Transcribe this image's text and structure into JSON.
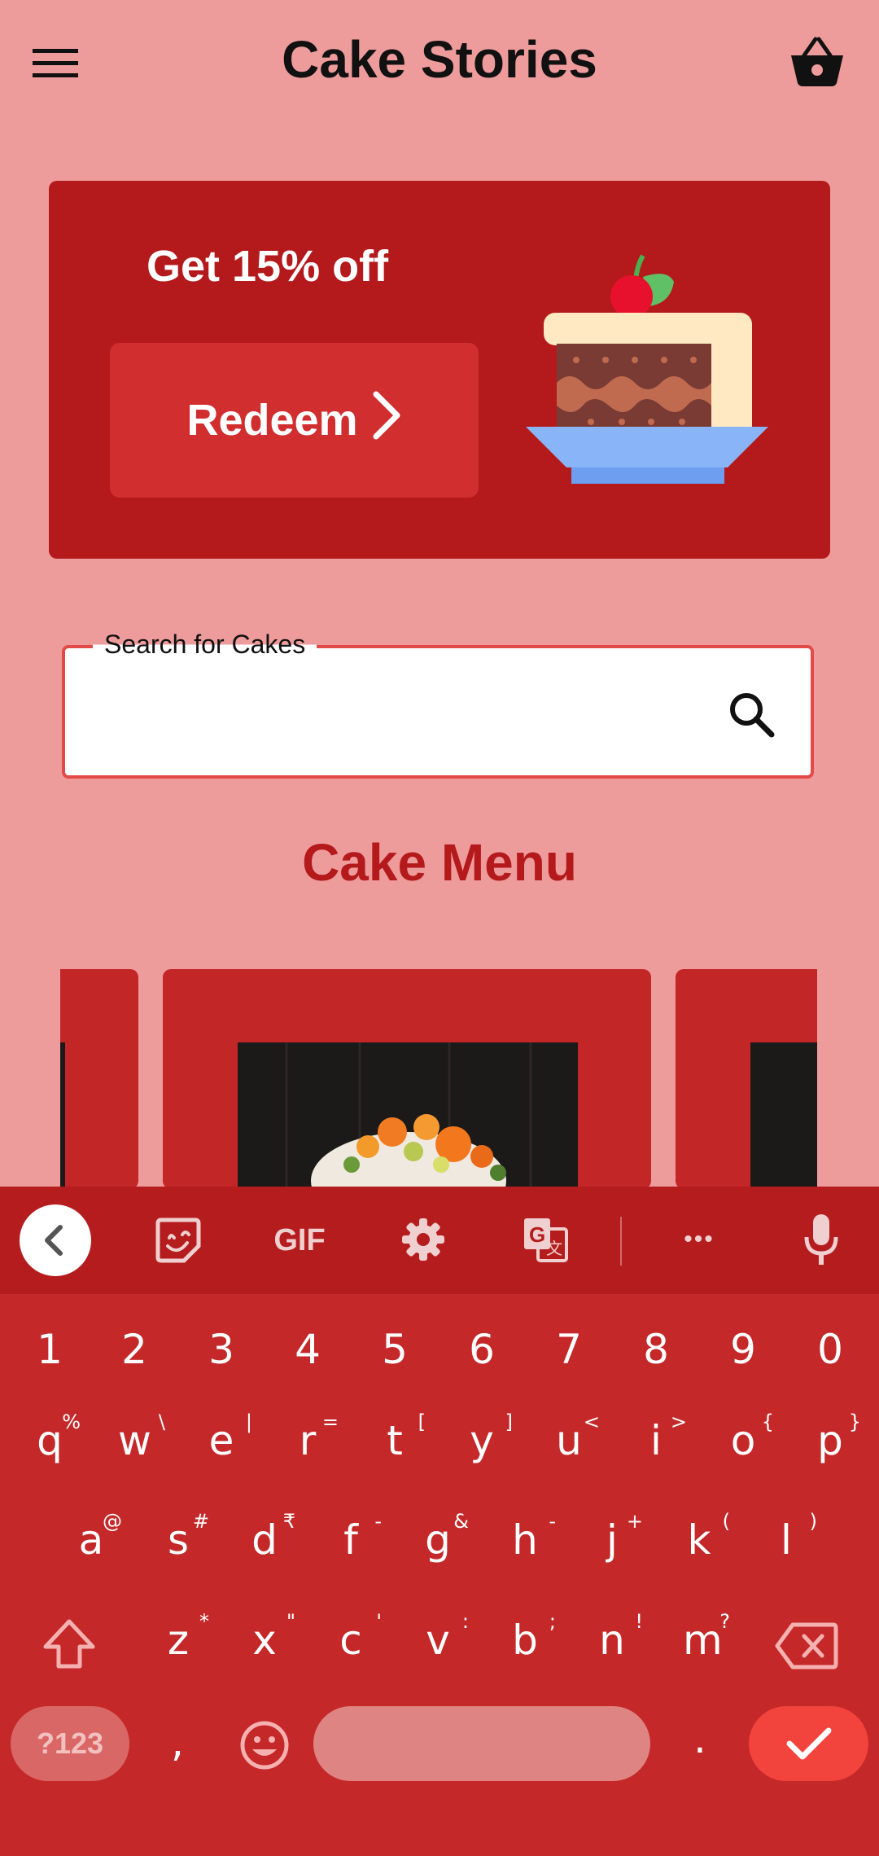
{
  "app": {
    "title": "Cake Stories"
  },
  "promo": {
    "text": "Get 15% off",
    "button_label": "Redeem"
  },
  "search": {
    "label": "Search for Cakes",
    "value": ""
  },
  "menu": {
    "heading": "Cake Menu"
  },
  "keyboard": {
    "toolbar": [
      "sticker-icon",
      "GIF",
      "gear-icon",
      "translate-icon",
      "more-icon",
      "mic-icon"
    ],
    "gif_label": "GIF",
    "more_label": "•••",
    "numbers": [
      "1",
      "2",
      "3",
      "4",
      "5",
      "6",
      "7",
      "8",
      "9",
      "0"
    ],
    "row1": [
      {
        "k": "q",
        "s": "%"
      },
      {
        "k": "w",
        "s": "\\"
      },
      {
        "k": "e",
        "s": "|"
      },
      {
        "k": "r",
        "s": "="
      },
      {
        "k": "t",
        "s": "["
      },
      {
        "k": "y",
        "s": "]"
      },
      {
        "k": "u",
        "s": "<"
      },
      {
        "k": "i",
        "s": ">"
      },
      {
        "k": "o",
        "s": "{"
      },
      {
        "k": "p",
        "s": "}"
      }
    ],
    "row2": [
      {
        "k": "a",
        "s": "@"
      },
      {
        "k": "s",
        "s": "#"
      },
      {
        "k": "d",
        "s": "₹"
      },
      {
        "k": "f",
        "s": "-"
      },
      {
        "k": "g",
        "s": "&"
      },
      {
        "k": "h",
        "s": "-"
      },
      {
        "k": "j",
        "s": "+"
      },
      {
        "k": "k",
        "s": "("
      },
      {
        "k": "l",
        "s": ")"
      }
    ],
    "row3": [
      {
        "k": "z",
        "s": "*"
      },
      {
        "k": "x",
        "s": "\""
      },
      {
        "k": "c",
        "s": "'"
      },
      {
        "k": "v",
        "s": ":"
      },
      {
        "k": "b",
        "s": ";"
      },
      {
        "k": "n",
        "s": "!"
      },
      {
        "k": "m",
        "s": "?"
      }
    ],
    "symbols_label": "?123",
    "comma": ",",
    "period": "."
  },
  "colors": {
    "background": "#ee9b9c",
    "primary": "#b4191b",
    "card": "#c32627",
    "keyboard": "#c42829",
    "accent": "#f2433c"
  }
}
